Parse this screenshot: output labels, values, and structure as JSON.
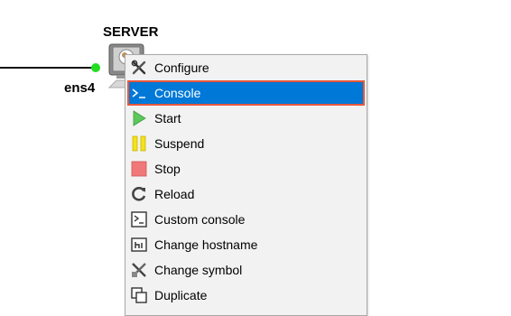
{
  "node": {
    "name": "SERVER",
    "interface": "ens4"
  },
  "menu": {
    "items": [
      {
        "label": "Configure",
        "icon": "wrench-screwdriver-icon"
      },
      {
        "label": "Console",
        "icon": "terminal-prompt-icon",
        "selected": true
      },
      {
        "label": "Start",
        "icon": "play-icon"
      },
      {
        "label": "Suspend",
        "icon": "pause-icon"
      },
      {
        "label": "Stop",
        "icon": "stop-icon"
      },
      {
        "label": "Reload",
        "icon": "reload-icon"
      },
      {
        "label": "Custom console",
        "icon": "custom-console-icon"
      },
      {
        "label": "Change hostname",
        "icon": "hostname-icon"
      },
      {
        "label": "Change symbol",
        "icon": "change-symbol-icon"
      },
      {
        "label": "Duplicate",
        "icon": "duplicate-icon"
      }
    ]
  },
  "colors": {
    "selection": "#0078d7",
    "selection_border": "#e8573a",
    "link_dot": "#22dd22"
  }
}
